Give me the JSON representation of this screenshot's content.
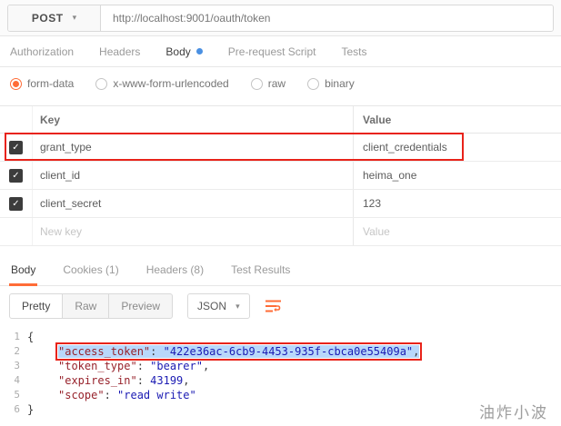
{
  "icons": {
    "chevron_down": "▾",
    "check": "✓"
  },
  "request": {
    "method": "POST",
    "url": "http://localhost:9001/oauth/token"
  },
  "request_tabs": {
    "authorization": "Authorization",
    "headers": "Headers",
    "body": "Body",
    "pre_request": "Pre-request Script",
    "tests": "Tests"
  },
  "body_types": {
    "form_data": "form-data",
    "urlencoded": "x-www-form-urlencoded",
    "raw": "raw",
    "binary": "binary"
  },
  "form_table": {
    "key_header": "Key",
    "value_header": "Value",
    "rows": [
      {
        "key": "grant_type",
        "value": "client_credentials",
        "checked": true,
        "annotated": true
      },
      {
        "key": "client_id",
        "value": "heima_one",
        "checked": true
      },
      {
        "key": "client_secret",
        "value": "123",
        "checked": true
      }
    ],
    "new_key_placeholder": "New key",
    "value_placeholder": "Value"
  },
  "response_tabs": {
    "body": "Body",
    "cookies": "Cookies (1)",
    "headers": "Headers (8)",
    "test_results": "Test Results"
  },
  "view_toolbar": {
    "pretty": "Pretty",
    "raw": "Raw",
    "preview": "Preview",
    "format": "JSON"
  },
  "response_body": {
    "lines": [
      {
        "num": "1",
        "text": "{"
      },
      {
        "num": "2",
        "key": "\"access_token\"",
        "sep": ": ",
        "value": "\"422e36ac-6cb9-4453-935f-cbca0e55409a\"",
        "comma": ",",
        "selected": true,
        "annotated": true
      },
      {
        "num": "3",
        "key": "\"token_type\"",
        "sep": ": ",
        "value": "\"bearer\"",
        "comma": ","
      },
      {
        "num": "4",
        "key": "\"expires_in\"",
        "sep": ": ",
        "value": "43199",
        "comma": ","
      },
      {
        "num": "5",
        "key": "\"scope\"",
        "sep": ": ",
        "value": "\"read write\""
      },
      {
        "num": "6",
        "text": "}"
      }
    ]
  },
  "colors": {
    "accent_orange": "#ff6c37",
    "annotation_red": "#e8231a",
    "active_tab_dot_blue": "#4a90e2",
    "json_key": "#97222b",
    "json_string": "#1b1bb3",
    "selection_blue": "#b8d8fb"
  },
  "watermark": "油炸小波"
}
